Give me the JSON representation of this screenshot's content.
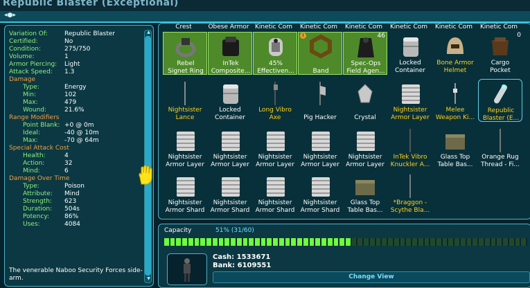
{
  "window": {
    "title": "Republic Blaster (Exceptional)"
  },
  "attributes": [
    {
      "label": "Variation Of:",
      "value": "Republic Blaster",
      "kind": "attr",
      "indent": false
    },
    {
      "label": "Certified:",
      "value": "No",
      "kind": "attr",
      "indent": false
    },
    {
      "label": "Condition:",
      "value": "275/750",
      "kind": "attr",
      "indent": false
    },
    {
      "label": "Volume:",
      "value": "1",
      "kind": "attr",
      "indent": false
    },
    {
      "label": "Armor Piercing:",
      "value": "Light",
      "kind": "attr",
      "indent": false
    },
    {
      "label": "Attack Speed:",
      "value": "1.3",
      "kind": "attr",
      "indent": false
    },
    {
      "label": "Damage",
      "value": "",
      "kind": "header",
      "indent": false
    },
    {
      "label": "Type:",
      "value": "Energy",
      "kind": "attr",
      "indent": true
    },
    {
      "label": "Min:",
      "value": "102",
      "kind": "attr",
      "indent": true
    },
    {
      "label": "Max:",
      "value": "479",
      "kind": "attr",
      "indent": true
    },
    {
      "label": "Wound:",
      "value": "21.6%",
      "kind": "attr",
      "indent": true
    },
    {
      "label": "Range Modifiers",
      "value": "",
      "kind": "header",
      "indent": false
    },
    {
      "label": "Point Blank:",
      "value": "+0 @ 0m",
      "kind": "attr",
      "indent": true
    },
    {
      "label": "Ideal:",
      "value": "-40 @ 10m",
      "kind": "attr",
      "indent": true
    },
    {
      "label": "Max:",
      "value": "-70 @ 64m",
      "kind": "attr",
      "indent": true
    },
    {
      "label": "Special Attack Cost",
      "value": "",
      "kind": "header",
      "indent": false
    },
    {
      "label": "Health:",
      "value": "4",
      "kind": "attr",
      "indent": true
    },
    {
      "label": "Action:",
      "value": "32",
      "kind": "attr",
      "indent": true
    },
    {
      "label": "Mind:",
      "value": "6",
      "kind": "attr",
      "indent": true
    },
    {
      "label": "Damage Over Time",
      "value": "",
      "kind": "header",
      "indent": false
    },
    {
      "label": "Type:",
      "value": "Poison",
      "kind": "attr",
      "indent": true
    },
    {
      "label": "Attribute:",
      "value": "Mind",
      "kind": "attr",
      "indent": true
    },
    {
      "label": "Strength:",
      "value": "623",
      "kind": "attr",
      "indent": true
    },
    {
      "label": "Duration:",
      "value": "504s",
      "kind": "attr",
      "indent": true
    },
    {
      "label": "Potency:",
      "value": "86%",
      "kind": "attr",
      "indent": true
    },
    {
      "label": "Uses:",
      "value": "4084",
      "kind": "attr",
      "indent": true
    }
  ],
  "description": "The venerable Naboo Security Forces side-arm.",
  "inventory": {
    "partial_top_labels": [
      "Crest",
      "Obese Armor",
      "Kinetic Com",
      "Kinetic Com",
      "Kinetic Com",
      "Kinetic Com",
      "Kinetic Com",
      "Kinetic Com"
    ],
    "rows": [
      [
        {
          "lines": [
            "Rebel",
            "Signet Ring"
          ],
          "color": "white",
          "selected": true,
          "icon": "ring-icon"
        },
        {
          "lines": [
            "InTek",
            "Composite..."
          ],
          "color": "white",
          "selected": true,
          "icon": "crate-icon"
        },
        {
          "lines": [
            "45%",
            "Effectiven..."
          ],
          "color": "white",
          "selected": true,
          "icon": "canister-icon"
        },
        {
          "lines": [
            "",
            "Band"
          ],
          "color": "white",
          "selected": true,
          "icon": "band-icon",
          "badge": "i"
        },
        {
          "lines": [
            "Spec-Ops",
            "Field Agen..."
          ],
          "color": "white",
          "selected": true,
          "icon": "cloak-icon",
          "count": "46"
        },
        {
          "lines": [
            "Locked",
            "Container"
          ],
          "color": "white",
          "selected": false,
          "icon": "container-icon"
        },
        {
          "lines": [
            "Bone Armor",
            "Helmet"
          ],
          "color": "yellow",
          "selected": false,
          "icon": "helmet-icon"
        },
        {
          "lines": [
            "Cargo",
            "Pocket"
          ],
          "color": "white",
          "selected": false,
          "icon": "pocket-icon",
          "count": "0"
        }
      ],
      [
        {
          "lines": [
            "",
            "Nightsister",
            "Lance"
          ],
          "color": "yellow",
          "selected": false,
          "icon": "lance-icon"
        },
        {
          "lines": [
            "Locked",
            "Container"
          ],
          "color": "white",
          "selected": false,
          "icon": "container-icon"
        },
        {
          "lines": [
            "Long Vibro",
            "Axe"
          ],
          "color": "yellow",
          "selected": false,
          "icon": "axe-icon"
        },
        {
          "lines": [
            "",
            "Pig Hacker"
          ],
          "color": "white",
          "selected": false,
          "icon": "hacker-icon"
        },
        {
          "lines": [
            "",
            "Crystal"
          ],
          "color": "white",
          "selected": false,
          "icon": "crystal-icon"
        },
        {
          "lines": [
            "Nightsister",
            "Armor Layer"
          ],
          "color": "yellow",
          "selected": false,
          "icon": "armor-icon"
        },
        {
          "lines": [
            "Melee",
            "Weapon Ki..."
          ],
          "color": "yellow",
          "selected": false,
          "icon": "weaponkit-icon"
        },
        {
          "lines": [
            "Republic",
            "Blaster (E..."
          ],
          "color": "yellow",
          "selected": false,
          "icon": "blaster-icon",
          "highlight": true
        }
      ],
      [
        {
          "lines": [
            "Nightsister",
            "Armor Layer"
          ],
          "color": "white",
          "selected": false,
          "icon": "armor-icon"
        },
        {
          "lines": [
            "Nightsister",
            "Armor Layer"
          ],
          "color": "white",
          "selected": false,
          "icon": "armor-icon"
        },
        {
          "lines": [
            "Nightsister",
            "Armor Layer"
          ],
          "color": "white",
          "selected": false,
          "icon": "armor-icon"
        },
        {
          "lines": [
            "Nightsister",
            "Armor Layer"
          ],
          "color": "white",
          "selected": false,
          "icon": "armor-icon"
        },
        {
          "lines": [
            "Nightsister",
            "Armor Layer"
          ],
          "color": "white",
          "selected": false,
          "icon": "armor-icon"
        },
        {
          "lines": [
            "InTek Vibro",
            "Knuckler A..."
          ],
          "color": "yellow",
          "selected": false,
          "icon": "knuckler-icon"
        },
        {
          "lines": [
            "Glass Top",
            "Table Bas..."
          ],
          "color": "white",
          "selected": false,
          "icon": "table-icon"
        },
        {
          "lines": [
            "Orange Rug",
            "Thread - Fi..."
          ],
          "color": "white",
          "selected": false,
          "icon": "rug-icon"
        }
      ],
      [
        {
          "lines": [
            "Nightsister",
            "Armor Shard"
          ],
          "color": "white",
          "selected": false,
          "icon": "armor-icon"
        },
        {
          "lines": [
            "Nightsister",
            "Armor Shard"
          ],
          "color": "white",
          "selected": false,
          "icon": "armor-icon"
        },
        {
          "lines": [
            "Nightsister",
            "Armor Shard"
          ],
          "color": "white",
          "selected": false,
          "icon": "armor-icon"
        },
        {
          "lines": [
            "Nightsister",
            "Armor Shard"
          ],
          "color": "white",
          "selected": false,
          "icon": "armor-icon"
        },
        {
          "lines": [
            "Glass Top",
            "Table Bas..."
          ],
          "color": "white",
          "selected": false,
          "icon": "table-icon"
        },
        {
          "lines": [
            "*Braggon -",
            "Scythe Bla..."
          ],
          "color": "yellow",
          "selected": false,
          "icon": "scythe-icon"
        }
      ]
    ]
  },
  "capacity": {
    "label": "Capacity",
    "percent_text": "51% (31/60)",
    "fill": 0.51,
    "segments": 60,
    "filled": 31
  },
  "money": {
    "cash_label": "Cash:",
    "cash": "1533671",
    "bank_label": "Bank:",
    "bank": "6109551"
  },
  "change_view_label": "Change View",
  "colors": {
    "attr_label": "#8ef27a",
    "section_header": "#f0a040",
    "item_yellow": "#ffd21a",
    "frame": "#4fb2c8",
    "capacity_fill": "#6cff3c"
  }
}
